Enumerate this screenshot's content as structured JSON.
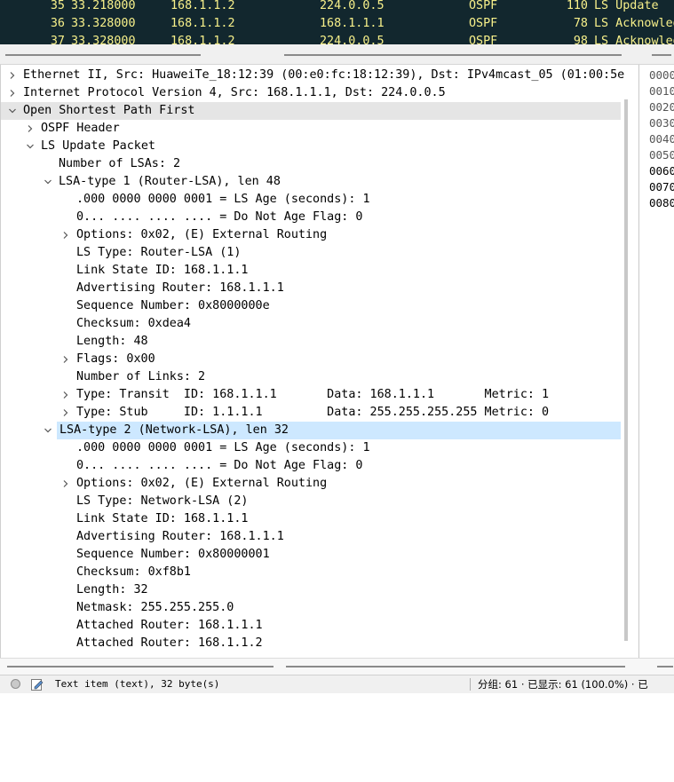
{
  "packet_list": [
    {
      "no": "35",
      "time": "33.218000",
      "src": "168.1.1.2",
      "dst": "224.0.0.5",
      "proto": "OSPF",
      "len": "110",
      "info": "LS Update"
    },
    {
      "no": "36",
      "time": "33.328000",
      "src": "168.1.1.2",
      "dst": "168.1.1.1",
      "proto": "OSPF",
      "len": "78",
      "info": "LS Acknowledge"
    },
    {
      "no": "37",
      "time": "33.328000",
      "src": "168.1.1.2",
      "dst": "224.0.0.5",
      "proto": "OSPF",
      "len": "98",
      "info": "LS Acknowledge"
    }
  ],
  "tree": [
    {
      "level": 0,
      "twisty": "collapsed",
      "text": "Ethernet II, Src: HuaweiTe_18:12:39 (00:e0:fc:18:12:39), Dst: IPv4mcast_05 (01:00:5e",
      "hl": "none"
    },
    {
      "level": 0,
      "twisty": "collapsed",
      "text": "Internet Protocol Version 4, Src: 168.1.1.1, Dst: 224.0.0.5",
      "hl": "none"
    },
    {
      "level": 0,
      "twisty": "expanded",
      "text": "Open Shortest Path First",
      "hl": "gray"
    },
    {
      "level": 1,
      "twisty": "collapsed",
      "text": "OSPF Header",
      "hl": "none"
    },
    {
      "level": 1,
      "twisty": "expanded",
      "text": "LS Update Packet",
      "hl": "none"
    },
    {
      "level": 2,
      "twisty": "none",
      "text": "Number of LSAs: 2",
      "hl": "none"
    },
    {
      "level": 2,
      "twisty": "expanded",
      "text": "LSA-type 1 (Router-LSA), len 48",
      "hl": "none"
    },
    {
      "level": 3,
      "twisty": "none",
      "text": ".000 0000 0000 0001 = LS Age (seconds): 1",
      "hl": "none"
    },
    {
      "level": 3,
      "twisty": "none",
      "text": "0... .... .... .... = Do Not Age Flag: 0",
      "hl": "none"
    },
    {
      "level": 3,
      "twisty": "collapsed",
      "text": "Options: 0x02, (E) External Routing",
      "hl": "none"
    },
    {
      "level": 3,
      "twisty": "none",
      "text": "LS Type: Router-LSA (1)",
      "hl": "none"
    },
    {
      "level": 3,
      "twisty": "none",
      "text": "Link State ID: 168.1.1.1",
      "hl": "none"
    },
    {
      "level": 3,
      "twisty": "none",
      "text": "Advertising Router: 168.1.1.1",
      "hl": "none"
    },
    {
      "level": 3,
      "twisty": "none",
      "text": "Sequence Number: 0x8000000e",
      "hl": "none"
    },
    {
      "level": 3,
      "twisty": "none",
      "text": "Checksum: 0xdea4",
      "hl": "none"
    },
    {
      "level": 3,
      "twisty": "none",
      "text": "Length: 48",
      "hl": "none"
    },
    {
      "level": 3,
      "twisty": "collapsed",
      "text": "Flags: 0x00",
      "hl": "none"
    },
    {
      "level": 3,
      "twisty": "none",
      "text": "Number of Links: 2",
      "hl": "none"
    },
    {
      "level": 3,
      "twisty": "collapsed",
      "text": "Type: Transit  ID: 168.1.1.1       Data: 168.1.1.1       Metric: 1",
      "hl": "none"
    },
    {
      "level": 3,
      "twisty": "collapsed",
      "text": "Type: Stub     ID: 1.1.1.1         Data: 255.255.255.255 Metric: 0",
      "hl": "none"
    },
    {
      "level": 2,
      "twisty": "expanded",
      "text": "LSA-type 2 (Network-LSA), len 32",
      "hl": "blue"
    },
    {
      "level": 3,
      "twisty": "none",
      "text": ".000 0000 0000 0001 = LS Age (seconds): 1",
      "hl": "none"
    },
    {
      "level": 3,
      "twisty": "none",
      "text": "0... .... .... .... = Do Not Age Flag: 0",
      "hl": "none"
    },
    {
      "level": 3,
      "twisty": "collapsed",
      "text": "Options: 0x02, (E) External Routing",
      "hl": "none"
    },
    {
      "level": 3,
      "twisty": "none",
      "text": "LS Type: Network-LSA (2)",
      "hl": "none"
    },
    {
      "level": 3,
      "twisty": "none",
      "text": "Link State ID: 168.1.1.1",
      "hl": "none"
    },
    {
      "level": 3,
      "twisty": "none",
      "text": "Advertising Router: 168.1.1.1",
      "hl": "none"
    },
    {
      "level": 3,
      "twisty": "none",
      "text": "Sequence Number: 0x80000001",
      "hl": "none"
    },
    {
      "level": 3,
      "twisty": "none",
      "text": "Checksum: 0xf8b1",
      "hl": "none"
    },
    {
      "level": 3,
      "twisty": "none",
      "text": "Length: 32",
      "hl": "none"
    },
    {
      "level": 3,
      "twisty": "none",
      "text": "Netmask: 255.255.255.0",
      "hl": "none"
    },
    {
      "level": 3,
      "twisty": "none",
      "text": "Attached Router: 168.1.1.1",
      "hl": "none"
    },
    {
      "level": 3,
      "twisty": "none",
      "text": "Attached Router: 168.1.1.2",
      "hl": "none"
    }
  ],
  "bytes_offsets": [
    "0000",
    "0010",
    "0020",
    "0030",
    "0040",
    "0050",
    "0060",
    "0070",
    "0080"
  ],
  "status": {
    "field_text": "Text item (text), 32 byte(s)",
    "stats": "分组: 61 · 已显示: 61 (100.0%) · 已"
  },
  "colors": {
    "packet_bg": "#12272e",
    "packet_fg": "#f7f08a",
    "selected_blue": "#cde8ff",
    "selected_gray": "#e5e5e5"
  }
}
